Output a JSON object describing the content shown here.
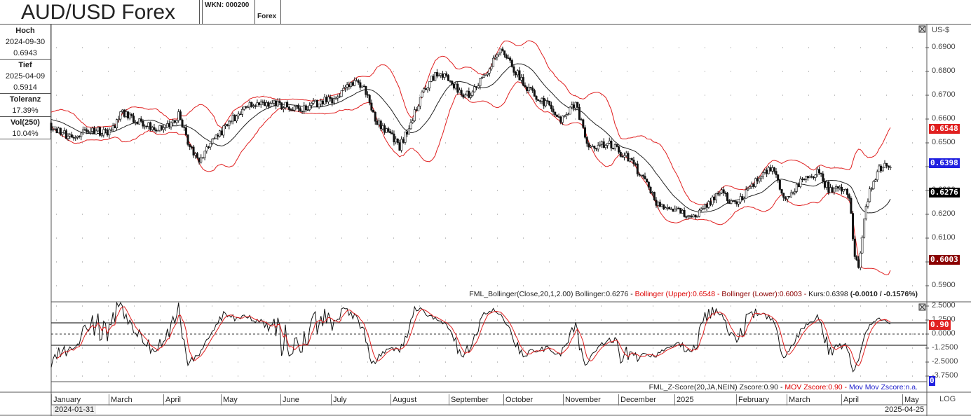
{
  "header": {
    "title": "AUD/USD Forex",
    "wkn": "WKN: 000200",
    "market": "Forex"
  },
  "stats": [
    {
      "label": "Hoch",
      "date": "2024-09-30",
      "value": "0.6943"
    },
    {
      "label": "Tief",
      "date": "2025-04-09",
      "value": "0.5914"
    },
    {
      "label": "Toleranz",
      "value": "17.39%"
    },
    {
      "label": "Vol(250)",
      "value": "10.04%"
    }
  ],
  "colors": {
    "upper": "#e02020",
    "lower": "#8b0000",
    "mid": "#000000",
    "last": "#2020e0",
    "zscore": "#000000",
    "mov_zscore": "#e02020"
  },
  "chart_data": [
    {
      "type": "candlestick",
      "unit": "US-$",
      "scale": "log",
      "ylim": [
        0.585,
        0.695
      ],
      "y_ticks": [
        "0.5900",
        "0.6000",
        "0.6100",
        "0.6200",
        "0.6300",
        "0.6400",
        "0.6500",
        "0.6600",
        "0.6700",
        "0.6800",
        "0.6900"
      ],
      "grid": true,
      "price_tags": [
        {
          "name": "Bollinger (Upper)",
          "value": "0.6548",
          "color": "#e02020"
        },
        {
          "name": "Kurs",
          "value": "0.6398",
          "color": "#2020e0"
        },
        {
          "name": "Bollinger",
          "value": "0.6276",
          "color": "#000000"
        },
        {
          "name": "Bollinger (Lower)",
          "value": "0.6003",
          "color": "#8b0000"
        }
      ],
      "legend": {
        "base": "FML_Bollinger(Close,20,1,2.00) Bollinger:0.6276 - ",
        "upper": "Bollinger (Upper):0.6548 - ",
        "lower": "Bollinger (Lower):0.6003 - ",
        "kurs": "Kurs:0.6398 ",
        "change": "(-0.0010 / -0.1576%)"
      },
      "approx_close": [
        [
          "2024-01-31",
          0.657
        ],
        [
          "2024-02-10",
          0.6527
        ],
        [
          "2024-02-21",
          0.6556
        ],
        [
          "2024-03-02",
          0.6541
        ],
        [
          "2024-03-09",
          0.663
        ],
        [
          "2024-03-19",
          0.6585
        ],
        [
          "2024-03-30",
          0.6556
        ],
        [
          "2024-04-08",
          0.6615
        ],
        [
          "2024-04-14",
          0.6482
        ],
        [
          "2024-04-19",
          0.6418
        ],
        [
          "2024-04-25",
          0.6512
        ],
        [
          "2024-05-02",
          0.6556
        ],
        [
          "2024-05-12",
          0.6644
        ],
        [
          "2024-05-21",
          0.6674
        ],
        [
          "2024-06-01",
          0.6659
        ],
        [
          "2024-06-13",
          0.6644
        ],
        [
          "2024-06-24",
          0.6674
        ],
        [
          "2024-07-01",
          0.6688
        ],
        [
          "2024-07-09",
          0.6762
        ],
        [
          "2024-07-16",
          0.6732
        ],
        [
          "2024-07-22",
          0.66
        ],
        [
          "2024-07-31",
          0.6527
        ],
        [
          "2024-08-04",
          0.6482
        ],
        [
          "2024-08-10",
          0.6585
        ],
        [
          "2024-08-15",
          0.6688
        ],
        [
          "2024-08-23",
          0.6791
        ],
        [
          "2024-08-30",
          0.6776
        ],
        [
          "2024-09-07",
          0.6688
        ],
        [
          "2024-09-14",
          0.6732
        ],
        [
          "2024-09-22",
          0.6835
        ],
        [
          "2024-09-27",
          0.6894
        ],
        [
          "2024-10-03",
          0.682
        ],
        [
          "2024-10-11",
          0.6732
        ],
        [
          "2024-10-22",
          0.6659
        ],
        [
          "2024-10-29",
          0.66
        ],
        [
          "2024-11-06",
          0.6659
        ],
        [
          "2024-11-13",
          0.6482
        ],
        [
          "2024-11-24",
          0.6497
        ],
        [
          "2024-12-06",
          0.6424
        ],
        [
          "2024-12-13",
          0.6335
        ],
        [
          "2024-12-19",
          0.6247
        ],
        [
          "2024-12-28",
          0.6218
        ],
        [
          "2025-01-08",
          0.6188
        ],
        [
          "2025-01-16",
          0.6247
        ],
        [
          "2025-01-23",
          0.6291
        ],
        [
          "2025-01-31",
          0.6232
        ],
        [
          "2025-02-07",
          0.6321
        ],
        [
          "2025-02-19",
          0.6394
        ],
        [
          "2025-02-26",
          0.6247
        ],
        [
          "2025-03-06",
          0.6335
        ],
        [
          "2025-03-15",
          0.6379
        ],
        [
          "2025-03-21",
          0.6306
        ],
        [
          "2025-03-28",
          0.6312
        ],
        [
          "2025-04-01",
          0.6276
        ],
        [
          "2025-04-04",
          0.6012
        ],
        [
          "2025-04-06",
          0.5982
        ],
        [
          "2025-04-10",
          0.6247
        ],
        [
          "2025-04-16",
          0.6379
        ],
        [
          "2025-04-20",
          0.6409
        ],
        [
          "2025-04-23",
          0.6398
        ]
      ]
    },
    {
      "type": "line",
      "y_ticks": [
        "2.5000",
        "1.2500",
        "0.0000",
        "-1.2500",
        "-2.5000",
        "-3.7500"
      ],
      "ylim": [
        -4.0,
        2.8
      ],
      "reference_lines": [
        1,
        0,
        -1
      ],
      "tags": [
        {
          "value": "0.90",
          "color": "#e02020"
        },
        {
          "value": "0",
          "color": "#2020e0"
        }
      ],
      "legend": {
        "base": "FML_Z-Score(20,JA,NEIN) Zscore:0.90 - ",
        "mov": "MOV Zscore:0.90 - ",
        "movmov": "Mov Mov Zscore:n.a."
      }
    }
  ],
  "x_axis": {
    "months": [
      "January",
      "March",
      "April",
      "May",
      "June",
      "July",
      "August",
      "September",
      "October",
      "November",
      "December",
      "2025",
      "February",
      "March",
      "April",
      "May"
    ],
    "start_date": "2024-01-31",
    "end_date": "2025-04-25",
    "scale_button": "LOG"
  }
}
